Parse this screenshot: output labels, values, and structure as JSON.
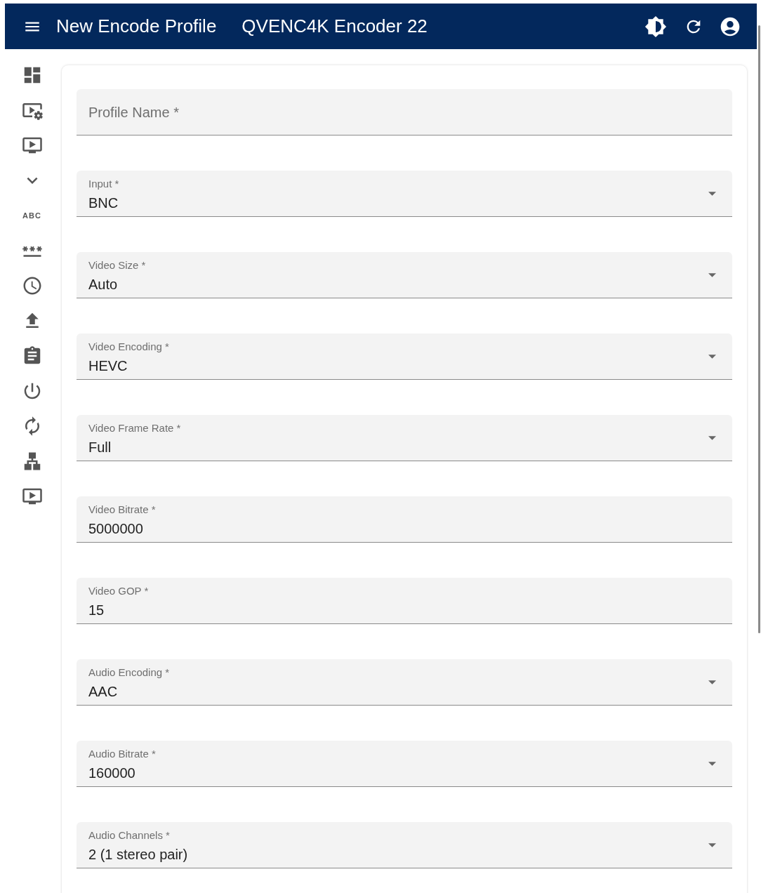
{
  "header": {
    "title": "New Encode Profile",
    "device": "QVENC4K Encoder 22"
  },
  "sidebar": {
    "text_item": "ABC"
  },
  "form": {
    "fields": [
      {
        "kind": "text",
        "label": "Profile Name *"
      },
      {
        "kind": "select",
        "label": "Input *",
        "value": "BNC"
      },
      {
        "kind": "select",
        "label": "Video Size *",
        "value": "Auto"
      },
      {
        "kind": "select",
        "label": "Video Encoding *",
        "value": "HEVC"
      },
      {
        "kind": "select",
        "label": "Video Frame Rate *",
        "value": "Full"
      },
      {
        "kind": "text",
        "label": "Video Bitrate *",
        "value": "5000000"
      },
      {
        "kind": "text",
        "label": "Video GOP *",
        "value": "15"
      },
      {
        "kind": "select",
        "label": "Audio Encoding *",
        "value": "AAC"
      },
      {
        "kind": "select",
        "label": "Audio Bitrate *",
        "value": "160000"
      },
      {
        "kind": "select",
        "label": "Audio Channels *",
        "value": "2 (1 stereo pair)"
      }
    ]
  }
}
